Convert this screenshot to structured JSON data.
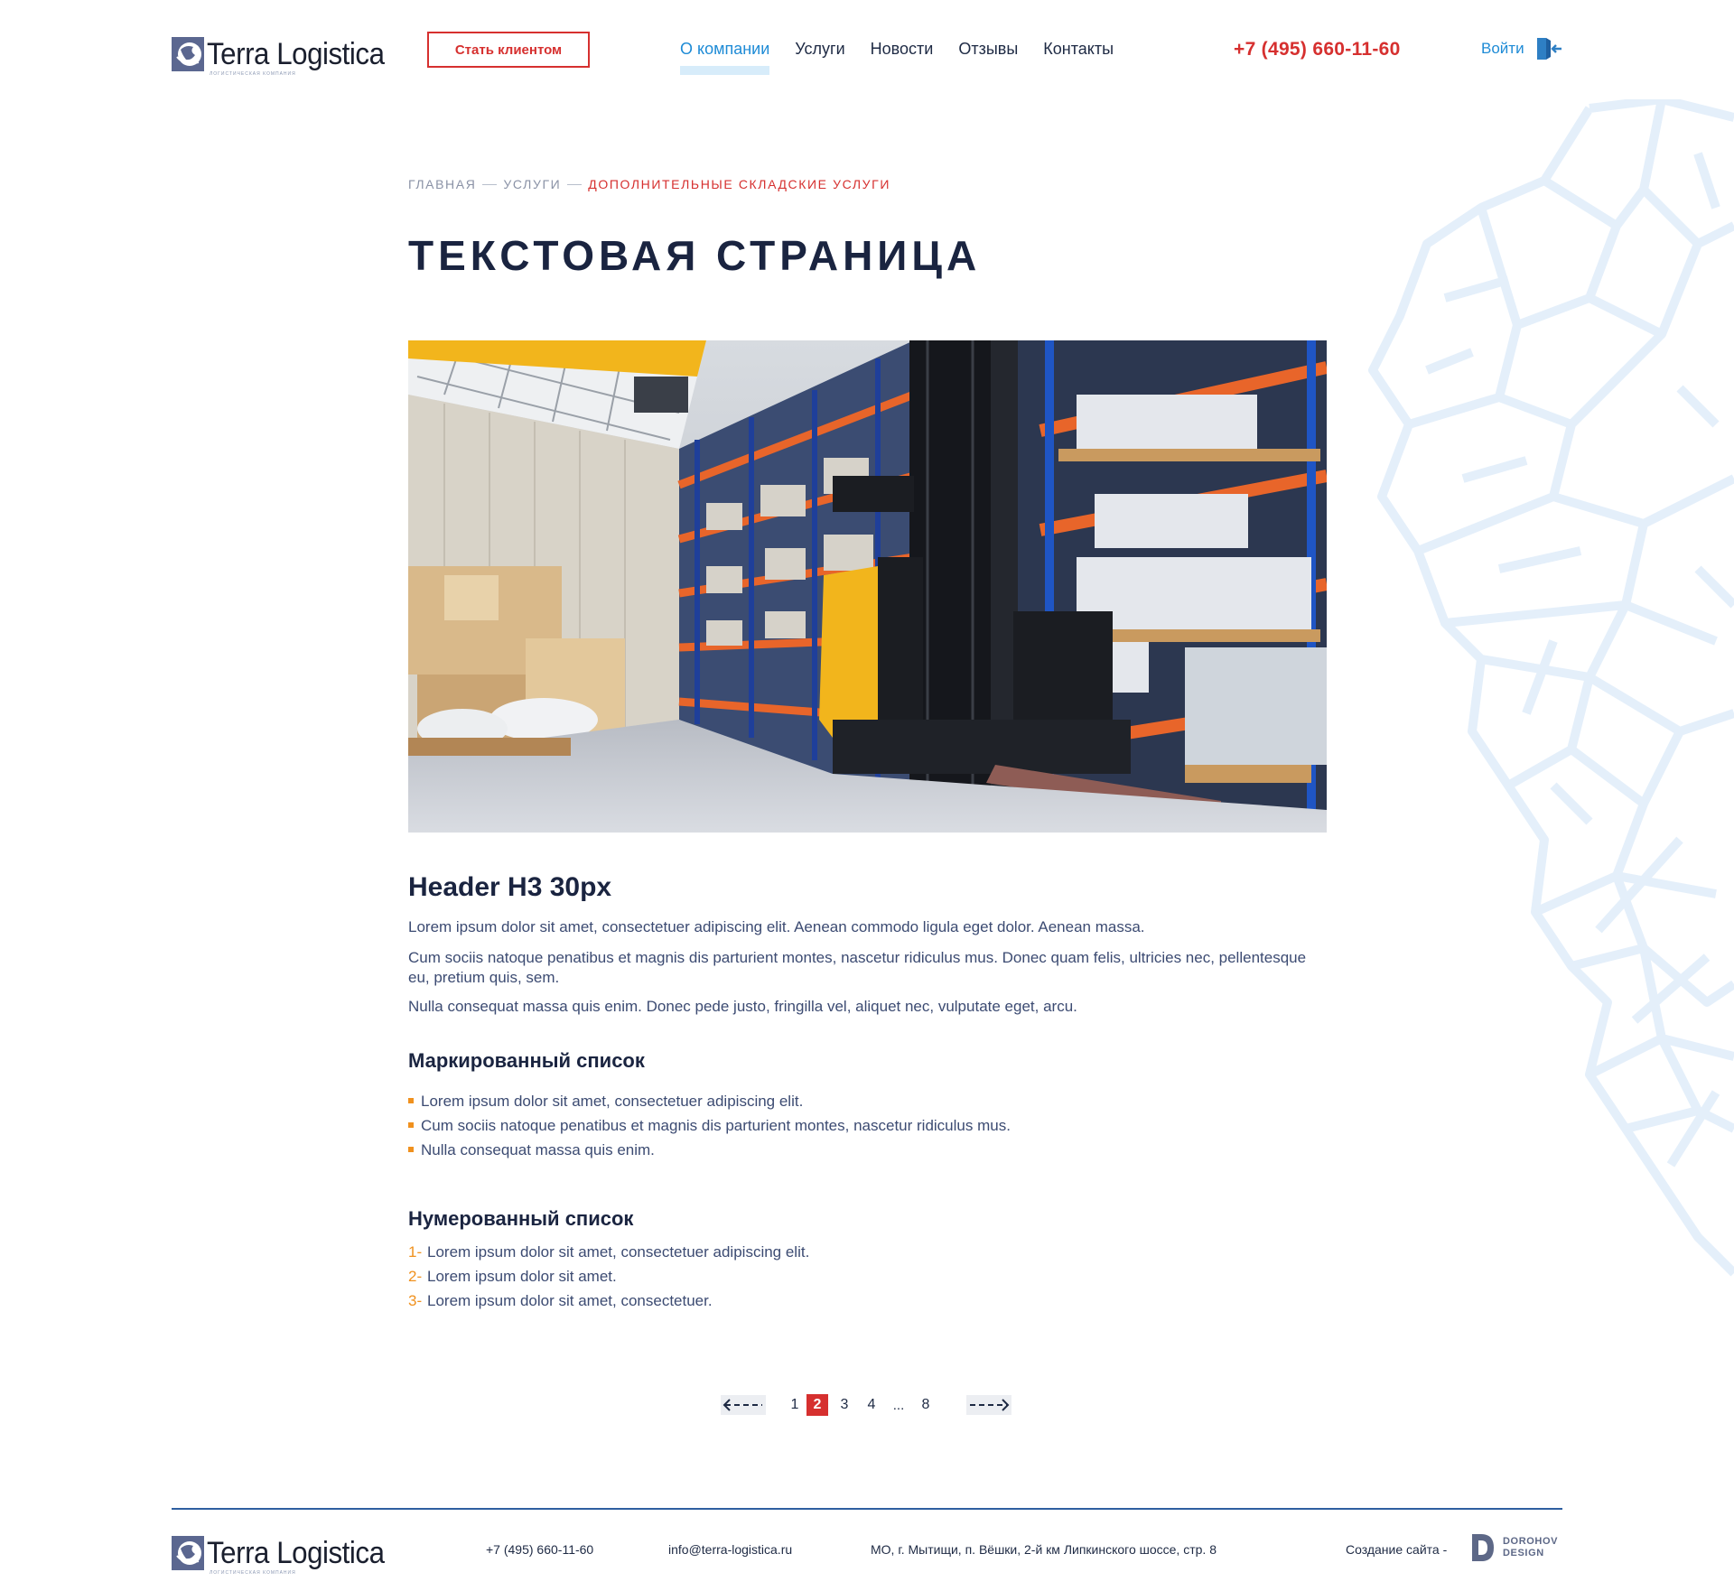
{
  "header": {
    "logo_text": "Terra Logistica",
    "logo_subtitle": "логистическая компания",
    "cta_label": "Стать клиентом",
    "nav": [
      {
        "label": "О компании",
        "active": true
      },
      {
        "label": "Услуги",
        "active": false
      },
      {
        "label": "Новости",
        "active": false
      },
      {
        "label": "Отзывы",
        "active": false
      },
      {
        "label": "Контакты",
        "active": false
      }
    ],
    "phone": "+7 (495) 660-11-60",
    "login_label": "Войти"
  },
  "breadcrumb": {
    "items": [
      "ГЛАВНАЯ",
      "УСЛУГИ"
    ],
    "current": "ДОПОЛНИТЕЛЬНЫЕ СКЛАДСКИЕ УСЛУГИ"
  },
  "page": {
    "title": "ТЕКСТОВАЯ СТРАНИЦА",
    "h3": "Header H3 30px",
    "paragraphs": [
      "Lorem ipsum dolor sit amet, consectetuer adipiscing elit. Aenean commodo ligula eget dolor. Aenean massa.",
      "Cum sociis natoque penatibus et magnis dis parturient montes, nascetur ridiculus mus. Donec quam felis, ultricies nec, pellentesque eu, pretium quis, sem.",
      "Nulla consequat massa quis enim. Donec pede justo, fringilla vel, aliquet nec, vulputate eget, arcu."
    ],
    "bulleted_title": "Маркированный список",
    "bullets": [
      "Lorem ipsum dolor sit amet, consectetuer adipiscing elit.",
      "Cum sociis natoque penatibus et magnis dis parturient montes, nascetur ridiculus mus.",
      "Nulla consequat massa quis enim."
    ],
    "numbered_title": "Нумерованный список",
    "numbered": [
      {
        "num": "1-",
        "text": "Lorem ipsum dolor sit amet, consectetuer adipiscing elit."
      },
      {
        "num": "2-",
        "text": "Lorem ipsum dolor sit amet."
      },
      {
        "num": "3-",
        "text": "Lorem ipsum dolor sit amet, consectetuer."
      }
    ]
  },
  "pagination": {
    "pages": [
      "1",
      "2",
      "3",
      "4"
    ],
    "ellipsis": "...",
    "last": "8",
    "current": "2"
  },
  "footer": {
    "logo_text": "Terra Logistica",
    "logo_subtitle": "логистическая компания",
    "phone": "+7 (495) 660-11-60",
    "email": "info@terra-logistica.ru",
    "address": "МО, г. Мытищи, п. Вёшки, 2-й км Липкинского шоссе, стр. 8",
    "credit": "Создание сайта -",
    "designer_line1": "DOROHOV",
    "designer_line2": "DESIGN"
  },
  "colors": {
    "accent_red": "#d6302f",
    "accent_blue": "#1e8bd6",
    "bullet_orange": "#f0911e",
    "text_dark": "#1a2440"
  },
  "icons": {
    "logo": "globe-logo-icon",
    "login": "door-enter-icon",
    "prev": "arrow-left-icon",
    "next": "arrow-right-icon"
  }
}
